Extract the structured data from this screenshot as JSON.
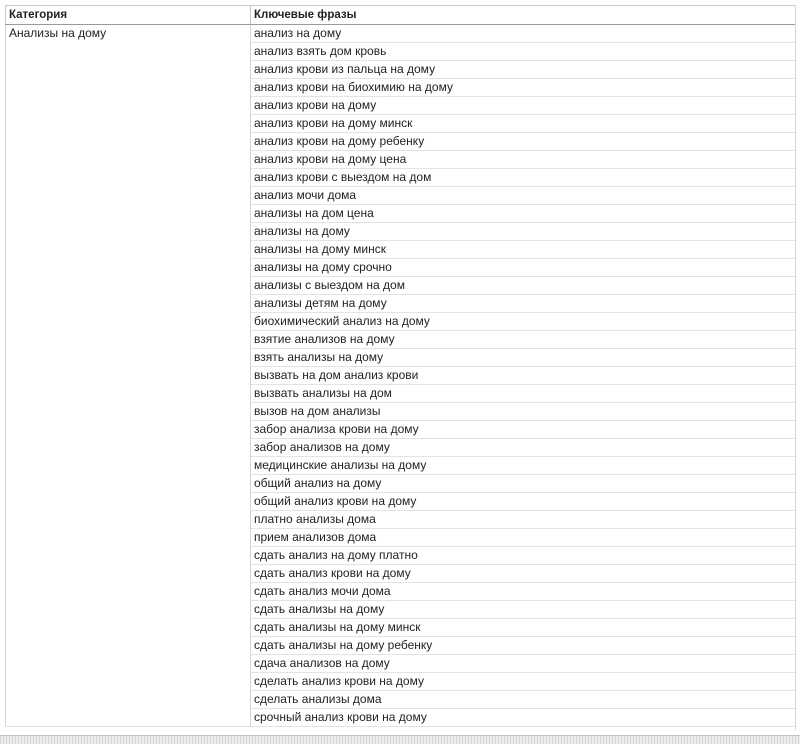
{
  "sheet": {
    "headers": {
      "category": "Категория",
      "keywords": "Ключевые фразы"
    },
    "category_value": "Анализы на дому",
    "keywords": [
      "анализ на дому",
      "анализ взять дом кровь",
      "анализ крови из пальца на дому",
      "анализ крови на биохимию на дому",
      "анализ крови на дому",
      "анализ крови на дому минск",
      "анализ крови на дому ребенку",
      "анализ крови на дому цена",
      "анализ крови с выездом на дом",
      "анализ мочи дома",
      "анализы на дом цена",
      "анализы на дому",
      "анализы на дому минск",
      "анализы на дому срочно",
      "анализы с выездом на дом",
      "анализы детям на дому",
      "биохимический анализ на дому",
      "взятие анализов на дому",
      "взять анализы на дому",
      "вызвать на дом анализ крови",
      "вызвать анализы на дом",
      "вызов на дом анализы",
      "забор анализа крови на дому",
      "забор анализов на дому",
      "медицинские анализы на дому",
      "общий анализ на дому",
      "общий анализ крови на дому",
      "платно анализы дома",
      "прием анализов дома",
      "сдать анализ на дому платно",
      "сдать анализ крови на дому",
      "сдать анализ мочи дома",
      "сдать анализы на дому",
      "сдать анализы на дому минск",
      "сдать анализы на дому ребенку",
      "сдача анализов на дому",
      "сделать анализ крови на дому",
      "сделать анализы дома",
      "срочный анализ крови на дому"
    ]
  }
}
